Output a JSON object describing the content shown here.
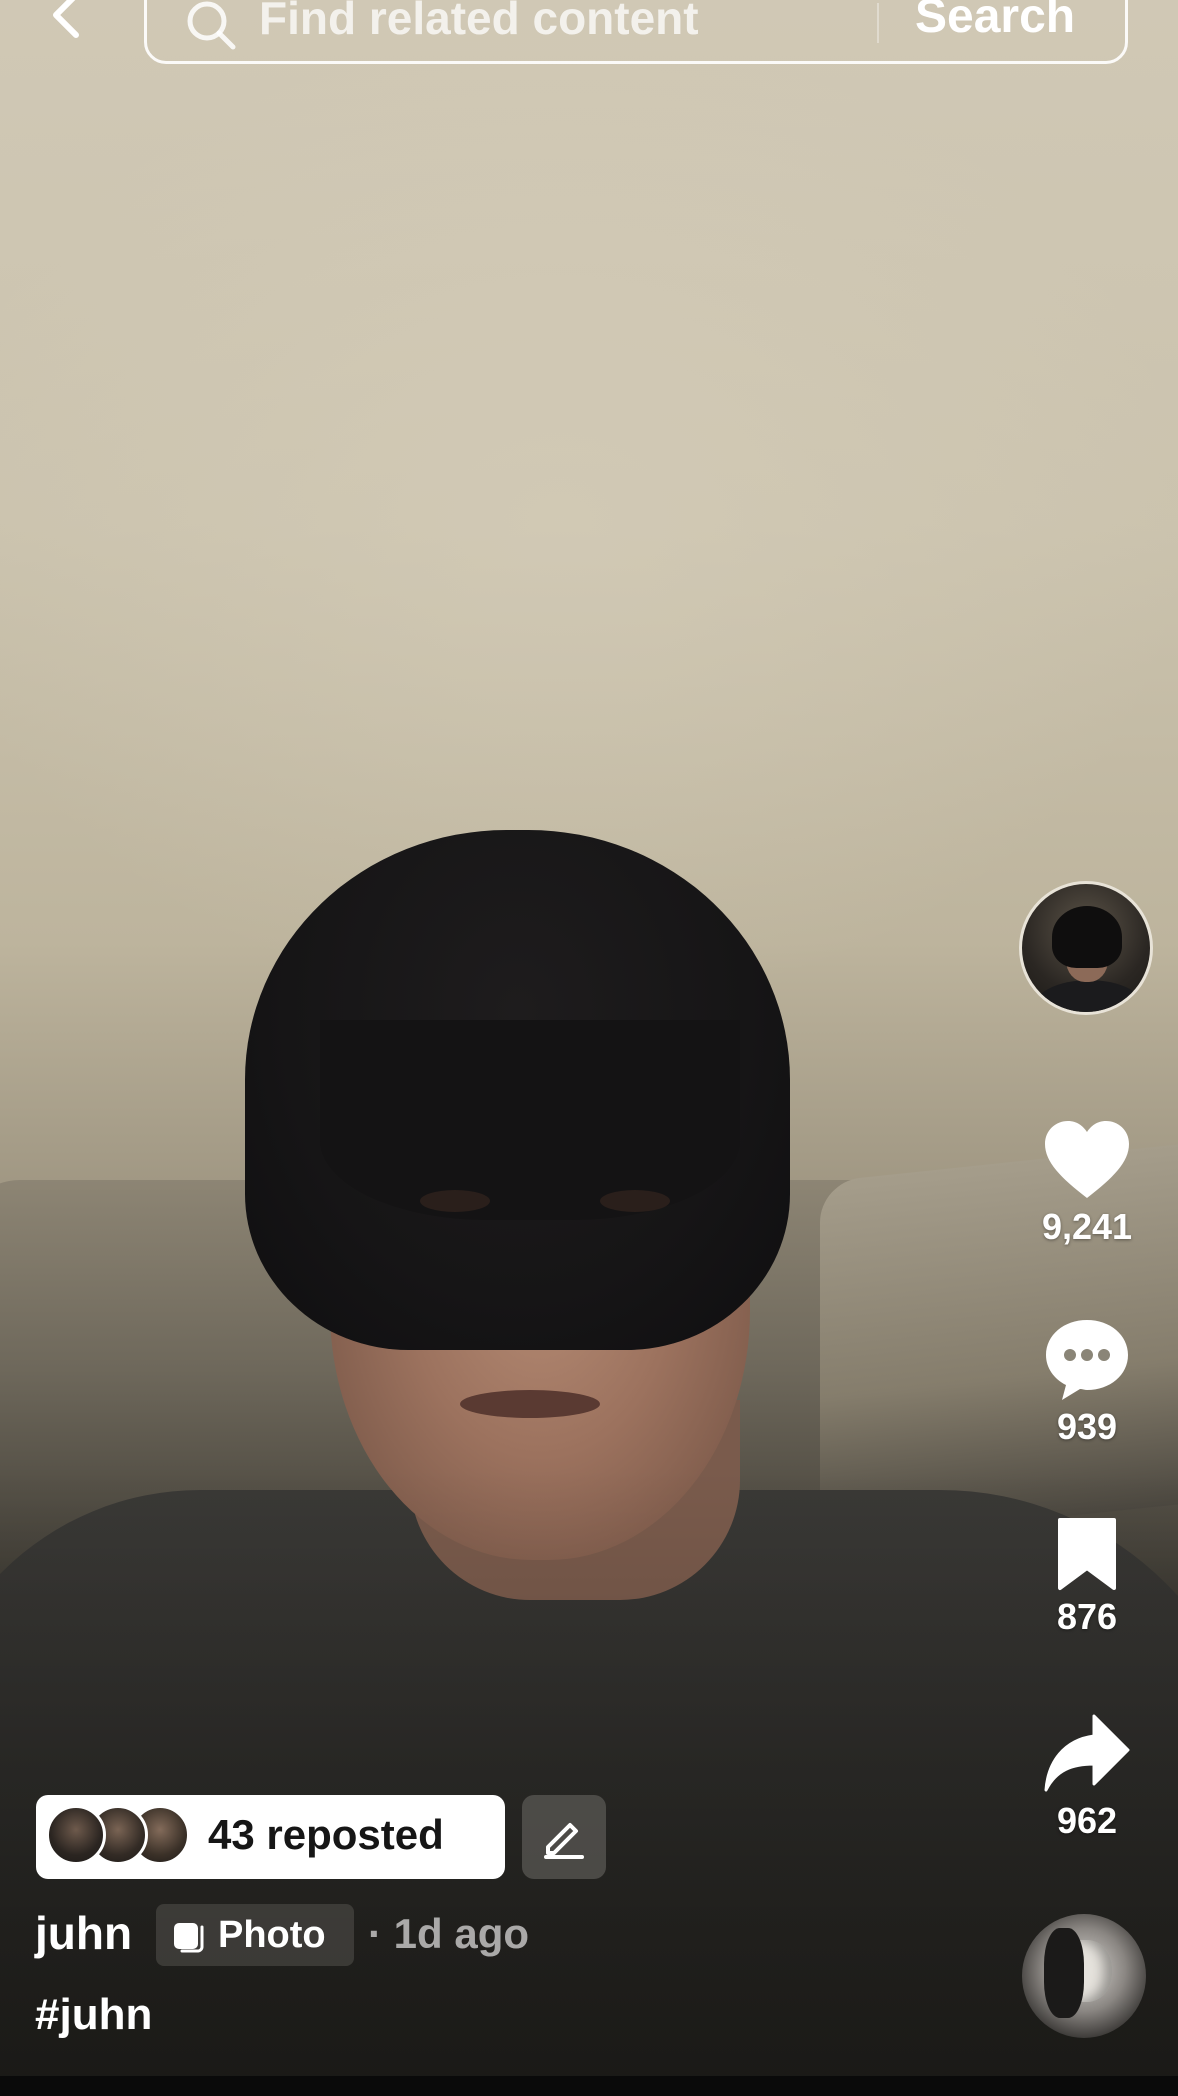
{
  "search": {
    "placeholder": "Find related content",
    "button_label": "Search"
  },
  "post": {
    "author_avatar_icon": "profile-avatar",
    "likes": "9,241",
    "comments": "939",
    "saves": "876",
    "shares": "962",
    "reposted_label": "43 reposted",
    "username": "juhn",
    "type_label": "Photo",
    "time_label": "· 1d ago",
    "hashtag": "#juhn"
  },
  "icons": {
    "back": "chevron-left-icon",
    "search": "search-icon",
    "like": "heart-icon",
    "comment": "comment-bubble-icon",
    "save": "bookmark-icon",
    "share": "share-arrow-icon",
    "edit": "pencil-icon",
    "photo": "photo-stack-icon",
    "sound": "sound-disc"
  },
  "colors": {
    "overlay_text": "#ffffff",
    "pill_background": "#ffffff",
    "muted_text": "rgba(255,255,255,0.62)"
  }
}
